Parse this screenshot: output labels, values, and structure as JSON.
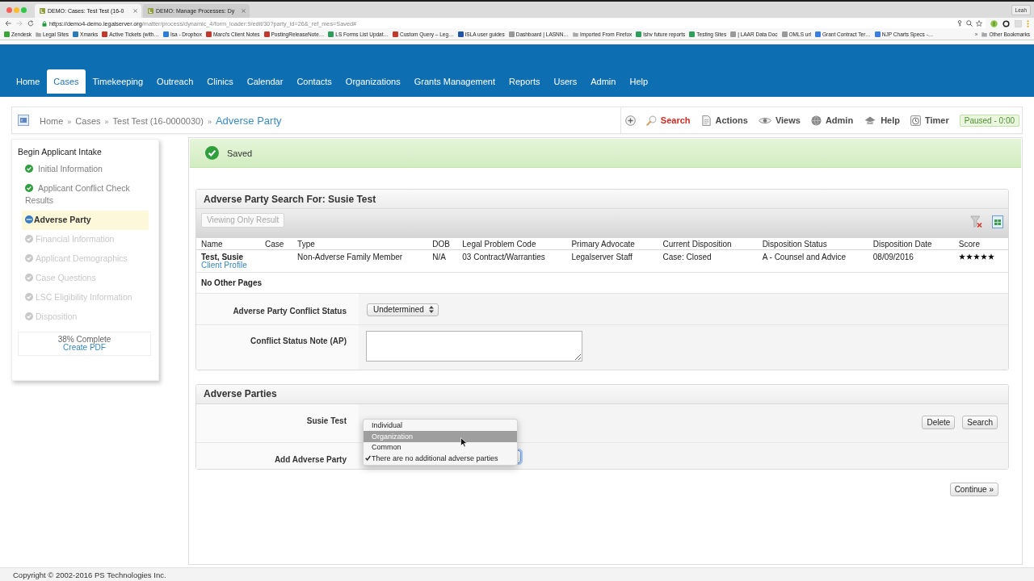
{
  "browser": {
    "tabs": [
      {
        "title": "DEMO: Cases: Test Test (16-0",
        "selected": true
      },
      {
        "title": "DEMO: Manage Processes: Dy",
        "selected": false
      }
    ],
    "profile": "Leah",
    "url": {
      "host": "https://demo4-demo.legalserver.org",
      "path": "/matter/process/dynamic_4/form_loader:9/edit/30?party_id=26&_ref_mes=Saved#"
    }
  },
  "bookmarks": {
    "items": [
      {
        "label": "Zendesk",
        "kind": "site",
        "color": "#3aa63a"
      },
      {
        "label": "Legal Sites",
        "kind": "folder"
      },
      {
        "label": "Xmarks",
        "kind": "site",
        "color": "#2a7ab8"
      },
      {
        "label": "Active Tickets (with…",
        "kind": "site",
        "color": "#c0392b"
      },
      {
        "label": "Isa - Dropbox",
        "kind": "site",
        "color": "#2b7fd8"
      },
      {
        "label": "Marci's Client Notes",
        "kind": "site",
        "color": "#c0392b"
      },
      {
        "label": "PostingReleaseNote…",
        "kind": "site",
        "color": "#c0392b"
      },
      {
        "label": "LS Forms List Updat…",
        "kind": "site",
        "color": "#2e9e5a"
      },
      {
        "label": "Custom Query – Leg…",
        "kind": "site",
        "color": "#c0392b"
      },
      {
        "label": "ISLA user guides",
        "kind": "site",
        "color": "#2255aa"
      },
      {
        "label": "Dashboard | LASNN…",
        "kind": "site",
        "color": "#999999"
      },
      {
        "label": "Imported From Firefox",
        "kind": "folder"
      },
      {
        "label": "lshv future reports",
        "kind": "site",
        "color": "#2e9e5a"
      },
      {
        "label": "Testing Sites",
        "kind": "site",
        "color": "#2e9e5a"
      },
      {
        "label": "| LAAR Data Doc",
        "kind": "site",
        "color": "#999999"
      },
      {
        "label": "OMLS url",
        "kind": "site",
        "color": "#999999"
      },
      {
        "label": "Grant Contract Ter…",
        "kind": "site",
        "color": "#3b7de0"
      },
      {
        "label": "NJP Charts Specs -…",
        "kind": "site",
        "color": "#3b7de0"
      }
    ],
    "overflow": "»",
    "other": {
      "label": "Other Bookmarks",
      "kind": "folder"
    }
  },
  "nav": {
    "items": [
      {
        "label": "Home",
        "selected": false
      },
      {
        "label": "Cases",
        "selected": true
      },
      {
        "label": "Timekeeping",
        "selected": false
      },
      {
        "label": "Outreach",
        "selected": false
      },
      {
        "label": "Clinics",
        "selected": false
      },
      {
        "label": "Calendar",
        "selected": false
      },
      {
        "label": "Contacts",
        "selected": false
      },
      {
        "label": "Organizations",
        "selected": false
      },
      {
        "label": "Grants Management",
        "selected": false
      },
      {
        "label": "Reports",
        "selected": false
      },
      {
        "label": "Users",
        "selected": false
      },
      {
        "label": "Admin",
        "selected": false
      },
      {
        "label": "Help",
        "selected": false
      }
    ]
  },
  "breadcrumb": {
    "items": [
      {
        "label": "Home",
        "kind": "link"
      },
      {
        "label": "»",
        "kind": "separator"
      },
      {
        "label": "Cases",
        "kind": "link"
      },
      {
        "label": "»",
        "kind": "separator"
      },
      {
        "label": "Test Test (16-0000030)",
        "kind": "link"
      },
      {
        "label": "»",
        "kind": "separator"
      },
      {
        "label": "Adverse Party",
        "kind": "current"
      }
    ]
  },
  "toolbar": {
    "items": [
      {
        "label": "Search",
        "kind": "search",
        "highlighted": true
      },
      {
        "label": "Actions",
        "kind": "actions",
        "highlighted": false
      },
      {
        "label": "Views",
        "kind": "views",
        "highlighted": false
      },
      {
        "label": "Admin",
        "kind": "admin",
        "highlighted": false
      },
      {
        "label": "Help",
        "kind": "help",
        "highlighted": false
      },
      {
        "label": "Timer",
        "kind": "timer",
        "highlighted": false
      }
    ],
    "timer_status": "Paused - 0:00"
  },
  "sidebar": {
    "title": "Begin Applicant Intake",
    "steps": [
      {
        "label": "Initial Information",
        "completed": true,
        "selected": false
      },
      {
        "label": "Applicant Conflict Check Results",
        "completed": true,
        "selected": false
      },
      {
        "label": "Adverse Party",
        "completed": false,
        "selected": true
      },
      {
        "label": "Financial Information",
        "completed": false,
        "selected": false
      },
      {
        "label": "Applicant Demographics",
        "completed": false,
        "selected": false
      },
      {
        "label": "Case Questions",
        "completed": false,
        "selected": false
      },
      {
        "label": "LSC Eligibility Information",
        "completed": false,
        "selected": false
      },
      {
        "label": "Disposition",
        "completed": false,
        "selected": false
      }
    ],
    "progress": "38% Complete",
    "pdf_link": "Create PDF"
  },
  "alert": {
    "kind": "success",
    "text": "Saved"
  },
  "search_results": {
    "title": "Adverse Party Search For: Susie Test",
    "view_button": {
      "label": "Viewing Only Result",
      "disabled": true
    },
    "table": {
      "columns": [
        "Name",
        "Case",
        "Type",
        "DOB",
        "Legal Problem Code",
        "Primary Advocate",
        "Current Disposition",
        "Disposition Status",
        "Disposition Date",
        "Score"
      ],
      "rows": [
        {
          "cells": [
            {
              "kind": "person",
              "name": "Test, Susie",
              "link": "Client Profile"
            },
            {
              "kind": "empty"
            },
            {
              "kind": "text",
              "text": "Non-Adverse Family Member"
            },
            {
              "kind": "text",
              "text": "N/A"
            },
            {
              "kind": "text",
              "text": "03 Contract/Warranties"
            },
            {
              "kind": "text",
              "text": "Legalserver Staff"
            },
            {
              "kind": "text",
              "text": "Case: Closed"
            },
            {
              "kind": "text",
              "text": "A - Counsel and Advice"
            },
            {
              "kind": "text",
              "text": "08/09/2016"
            },
            {
              "kind": "rating",
              "stars": 5
            }
          ]
        }
      ]
    },
    "pager": "No Other Pages",
    "fields": [
      {
        "label": "Adverse Party Conflict Status",
        "kind": "select",
        "value": "Undetermined"
      },
      {
        "label": "Conflict Status Note (AP)",
        "kind": "textarea"
      }
    ]
  },
  "adverse_parties": {
    "title": "Adverse Parties",
    "rows": [
      {
        "label": "Susie Test",
        "kind": "party",
        "buttons": [
          "Delete",
          "Search"
        ]
      },
      {
        "label": "Add Adverse Party",
        "kind": "add",
        "select": {
          "open": true,
          "focused": true,
          "options": [
            {
              "label": "Individual",
              "selected": false,
              "highlighted": false
            },
            {
              "label": "Organization",
              "selected": false,
              "highlighted": true
            },
            {
              "label": "Common",
              "selected": false,
              "highlighted": false
            },
            {
              "label": "There are no additional adverse parties",
              "selected": true,
              "highlighted": false
            }
          ]
        }
      }
    ]
  },
  "continue_button": "Continue »",
  "footer": "Copyright © 2002-2016 PS Technologies Inc."
}
